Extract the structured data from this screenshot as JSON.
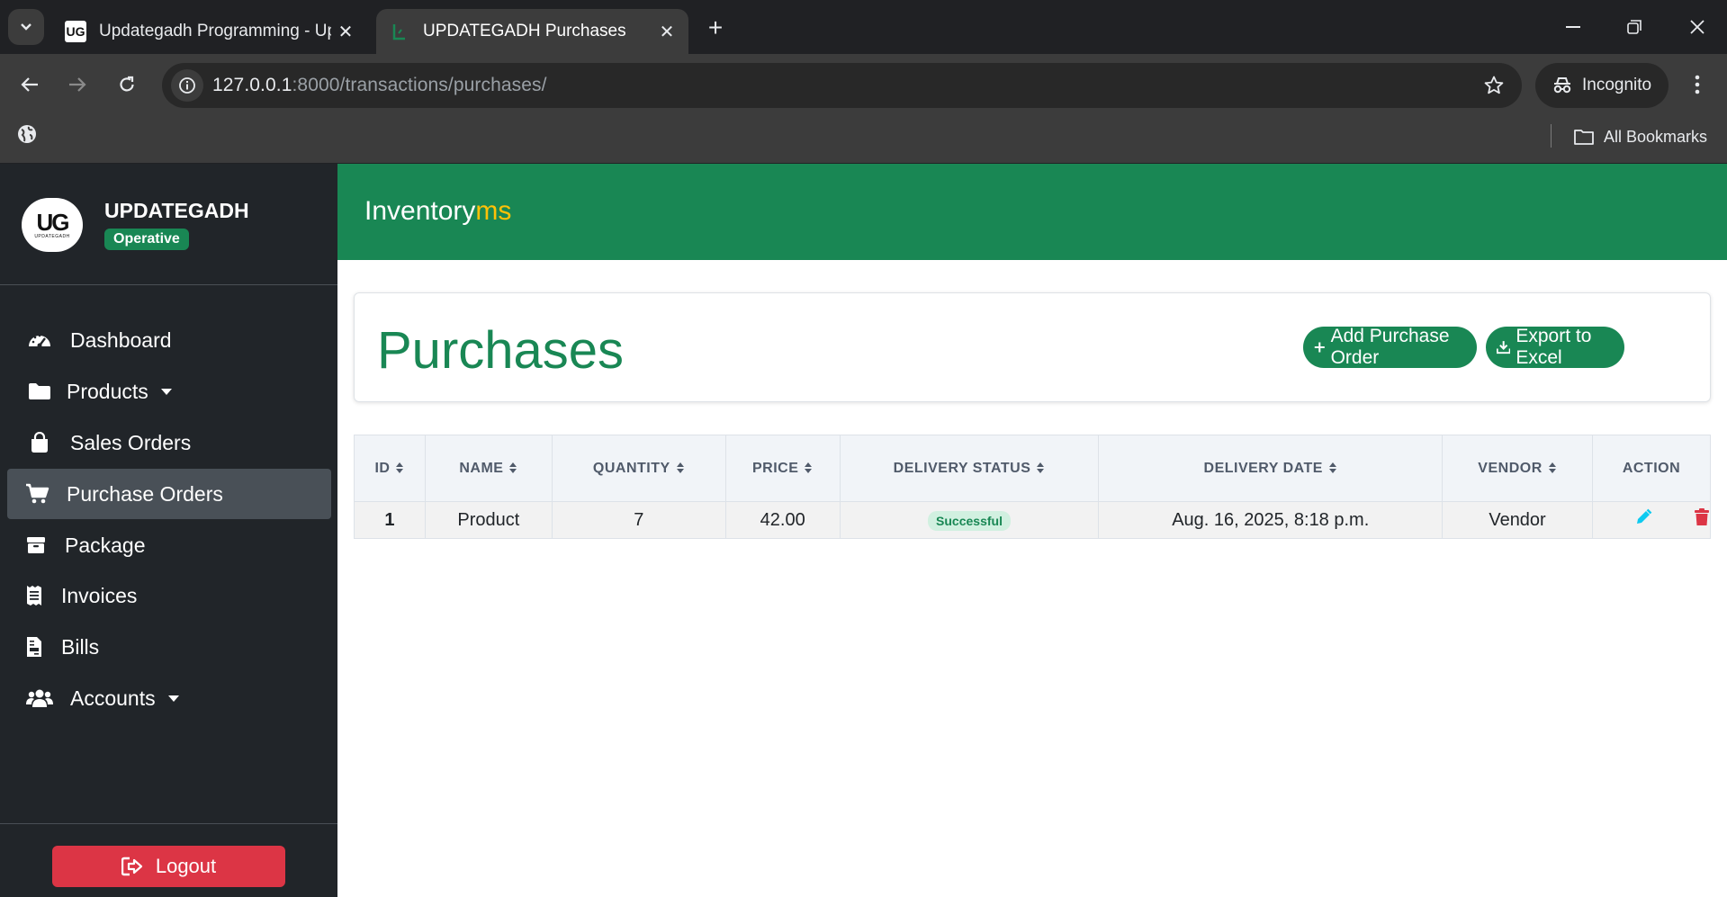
{
  "browser": {
    "tabs": [
      {
        "title": "Updategadh Programming - Up",
        "active": false
      },
      {
        "title": "UPDATEGADH Purchases",
        "active": true
      }
    ],
    "url_host": "127.0.0.1",
    "url_rest": ":8000/transactions/purchases/",
    "incognito_label": "Incognito",
    "bookmarks_label": "All Bookmarks"
  },
  "sidebar": {
    "logo_text": "UG",
    "logo_sub": "UPDATEGADH",
    "brand_name": "UPDATEGADH",
    "badge": "Operative",
    "items": [
      {
        "label": "Dashboard",
        "icon": "gauge-icon",
        "dropdown": false
      },
      {
        "label": "Products",
        "icon": "folder-icon",
        "dropdown": true
      },
      {
        "label": "Sales Orders",
        "icon": "shopping-bag-icon",
        "dropdown": false
      },
      {
        "label": "Purchase Orders",
        "icon": "cart-icon",
        "dropdown": false,
        "active": true
      },
      {
        "label": "Package",
        "icon": "box-icon",
        "dropdown": false
      },
      {
        "label": "Invoices",
        "icon": "receipt-icon",
        "dropdown": false
      },
      {
        "label": "Bills",
        "icon": "invoice-file-icon",
        "dropdown": false
      },
      {
        "label": "Accounts",
        "icon": "users-icon",
        "dropdown": true
      }
    ],
    "logout_label": "Logout"
  },
  "header": {
    "app_title_main": "Inventory",
    "app_title_accent": "ms"
  },
  "page": {
    "heading": "Purchases",
    "add_button": "Add Purchase Order",
    "export_button": "Export to Excel"
  },
  "table": {
    "columns": [
      "ID",
      "NAME",
      "QUANTITY",
      "PRICE",
      "DELIVERY STATUS",
      "DELIVERY DATE",
      "VENDOR",
      "ACTION"
    ],
    "rows": [
      {
        "id": "1",
        "name": "Product",
        "quantity": "7",
        "price": "42.00",
        "status": "Successful",
        "date": "Aug. 16, 2025, 8:18 p.m.",
        "vendor": "Vendor"
      }
    ]
  },
  "colors": {
    "brand_green": "#198754",
    "accent_yellow": "#ffc107",
    "sidebar_bg": "#212529",
    "danger": "#dc3545",
    "edit_blue": "#0dcaf0"
  }
}
